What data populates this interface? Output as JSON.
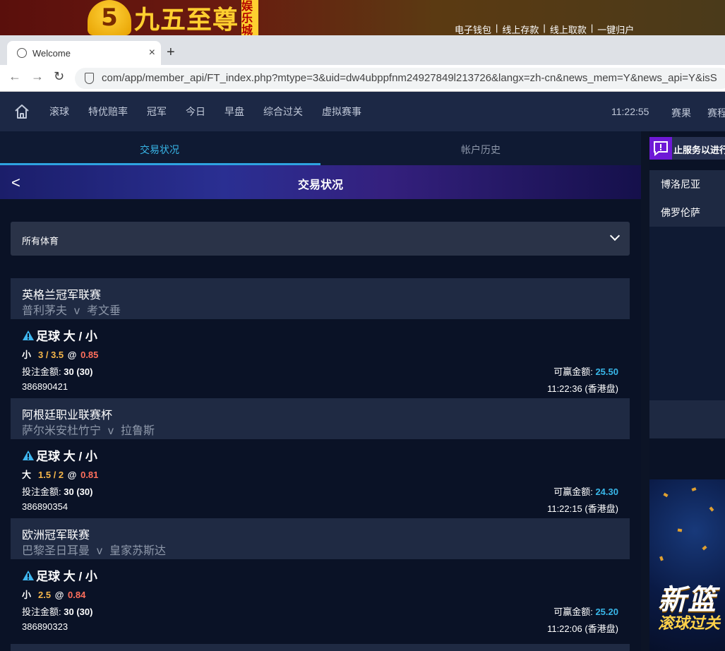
{
  "site": {
    "logo_glyph": "5",
    "logo_text": "九五至尊",
    "logo_sub": "娱乐城",
    "links": [
      "电子钱包",
      "线上存款",
      "线上取款",
      "一键归户"
    ],
    "link_sep": "|"
  },
  "browser": {
    "tab_title": "Welcome",
    "tab_close": "×",
    "new_tab": "+",
    "url": "com/app/member_api/FT_index.php?mtype=3&uid=dw4ubppfnm24927849l213726&langx=zh-cn&news_mem=Y&news_api=Y&isS",
    "back": "←",
    "forward": "→",
    "reload": "↻"
  },
  "nav": {
    "items": [
      "滚球",
      "特优赔率",
      "冠军",
      "今日",
      "早盘",
      "综合过关",
      "虚拟赛事"
    ],
    "time": "11:22:55",
    "results": "赛果",
    "rules": "赛程"
  },
  "tabs": {
    "active": "交易状况",
    "inactive": "帐户历史"
  },
  "hero": {
    "back": "<",
    "title": "交易状况"
  },
  "filter": {
    "label": "所有体育"
  },
  "labels": {
    "stake": "投注金额:",
    "win": "可赢金额:",
    "at": "@",
    "vs": "v"
  },
  "bets": [
    {
      "league": "英格兰冠军联赛",
      "home": "普利茅夫",
      "away": "考文垂",
      "market": "足球 大 / 小",
      "side": "小",
      "line": "3 / 3.5",
      "odds": "0.85",
      "stake": "30 (30)",
      "win": "25.50",
      "ticket": "386890421",
      "time": "11:22:36 (香港盘)"
    },
    {
      "league": "阿根廷职业联赛杯",
      "home": "萨尔米安杜竹宁",
      "away": "拉鲁斯",
      "market": "足球 大 / 小",
      "side": "大",
      "line": "1.5 / 2",
      "odds": "0.81",
      "stake": "30 (30)",
      "win": "24.30",
      "ticket": "386890354",
      "time": "11:22:15 (香港盘)"
    },
    {
      "league": "欧洲冠军联赛",
      "home": "巴黎圣日耳曼",
      "away": "皇家苏斯达",
      "market": "足球 大 / 小",
      "side": "小",
      "line": "2.5",
      "odds": "0.84",
      "stake": "30 (30)",
      "win": "25.20",
      "ticket": "386890323",
      "time": "11:22:06 (香港盘)"
    }
  ],
  "side": {
    "notice": "止服务以进行",
    "items": [
      "博洛尼亚",
      "佛罗伦萨"
    ],
    "promo_line1": "新篮",
    "promo_line2": "滚球过关"
  }
}
